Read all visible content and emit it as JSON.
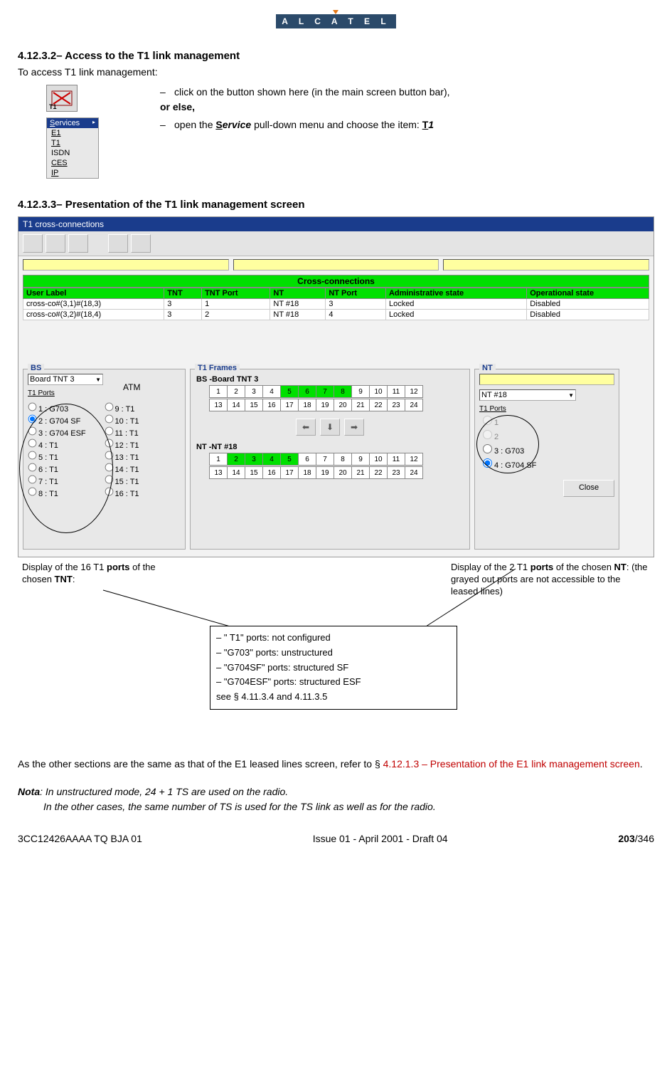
{
  "brand": "A L C A T E L",
  "h1": "4.12.3.2– Access to the T1 link management",
  "intro": "To access T1 link management:",
  "step1": "click on the button shown here (in the main screen button bar),",
  "orelse": "or else,",
  "step2_pre": "open the ",
  "step2_mid": "ervice",
  "step2_post": " pull-down menu and choose the item: ",
  "step2_item": "1",
  "t1btn_label": "T1",
  "services_menu": {
    "title": "Services",
    "items": [
      "E1",
      "T1",
      "ISDN",
      "CES",
      "IP"
    ]
  },
  "h2": "4.12.3.3– Presentation of the T1 link management screen",
  "win_title": "T1 cross-connections",
  "cross_title": "Cross-connections",
  "columns": [
    "User Label",
    "TNT",
    "TNT Port",
    "NT",
    "NT Port",
    "Administrative state",
    "Operational state"
  ],
  "rows": [
    [
      "cross-co#(3,1)#(18,3)",
      "3",
      "1",
      "NT #18",
      "3",
      "Locked",
      "Disabled"
    ],
    [
      "cross-co#(3,2)#(18,4)",
      "3",
      "2",
      "NT #18",
      "4",
      "Locked",
      "Disabled"
    ]
  ],
  "panel_bs": "BS",
  "panel_frames": "T1 Frames",
  "panel_nt": "NT",
  "bs_dropdown": "Board TNT 3",
  "atm": "ATM",
  "t1ports_label": "T1 Ports",
  "bs_ports_left": [
    "1 : G703",
    "2 : G704 SF",
    "3 : G704 ESF",
    "4 : T1",
    "5 : T1",
    "6 : T1",
    "7 : T1",
    "8 : T1"
  ],
  "bs_ports_right": [
    "9 : T1",
    "10 : T1",
    "11 : T1",
    "12 : T1",
    "13 : T1",
    "14 : T1",
    "15 : T1",
    "16 : T1"
  ],
  "bs_selected_index": 1,
  "frame_bs_title": "BS -Board TNT 3",
  "frame_nt_title": "NT -NT #18",
  "bs_green": [
    5,
    6,
    7,
    8
  ],
  "nt_green": [
    2,
    3,
    4,
    5
  ],
  "nt_dropdown": "NT #18",
  "nt_ports": [
    "1",
    "2",
    "3 : G703",
    "4 : G704 SF"
  ],
  "nt_selected_index": 3,
  "close": "Close",
  "callout_left_1": "Display of the 16 T1 ",
  "callout_left_2": "ports",
  "callout_left_3": " of the chosen ",
  "callout_left_4": "TNT",
  "callout_left_5": ":",
  "callout_right_1": "Display of the 2 T1 ",
  "callout_right_2": "ports",
  "callout_right_3": " of the chosen ",
  "callout_right_4": "NT",
  "callout_right_5": ": (the grayed out ports are not accessible to the leased lines)",
  "legend": [
    "– \" T1\" ports: not configured",
    "– \"G703\" ports: unstructured",
    "– \"G704SF\" ports: structured SF",
    "– \"G704ESF\" ports: structured ESF",
    "   see § 4.11.3.4 and 4.11.3.5"
  ],
  "body1_a": "As the other sections are the same as that of the E1 leased lines screen, refer to § ",
  "body1_b": "4.12.1.3 – Presentation of the E1 link management screen",
  "body1_c": ".",
  "nota_label": "Nota",
  "nota1": ": In unstructured mode, 24 + 1 TS are used on the radio.",
  "nota2": "In the other cases, the same number of TS is used for the TS link as well as for the radio.",
  "footer_left": "3CC12426AAAA TQ BJA 01",
  "footer_mid": "Issue 01 - April 2001 - Draft 04",
  "footer_page": "203",
  "footer_total": "/346"
}
